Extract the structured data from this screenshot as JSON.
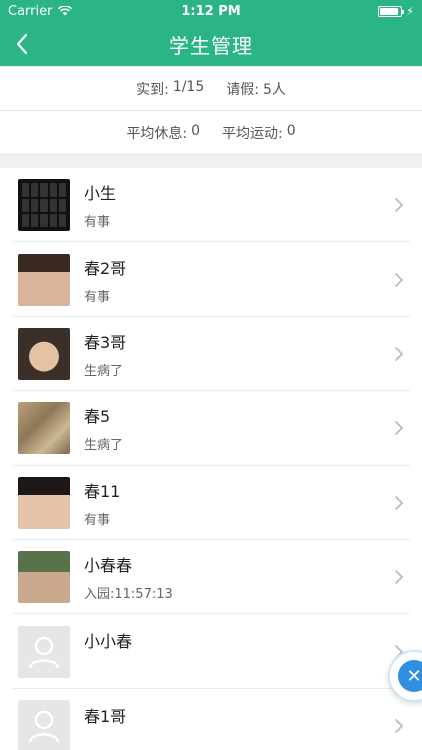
{
  "status_bar": {
    "carrier": "Carrier",
    "time": "1:12 PM",
    "battery_percent": 90
  },
  "nav": {
    "title": "学生管理"
  },
  "stats": {
    "arrived_label": "实到:",
    "arrived_value": "1/15",
    "leave_label": "请假:",
    "leave_value": "5人",
    "rest_label": "平均休息:",
    "rest_value": "0",
    "sport_label": "平均运动:",
    "sport_value": "0"
  },
  "students": [
    {
      "name": "小生",
      "status": "有事",
      "avatar": "keyboard-photo"
    },
    {
      "name": "春2哥",
      "status": "有事",
      "avatar": "face-photo"
    },
    {
      "name": "春3哥",
      "status": "生病了",
      "avatar": "face-photo"
    },
    {
      "name": "春5",
      "status": "生病了",
      "avatar": "ground-photo"
    },
    {
      "name": "春11",
      "status": "有事",
      "avatar": "face-photo"
    },
    {
      "name": "小春春",
      "status": "入园:11:57:13",
      "avatar": "face-photo"
    },
    {
      "name": "小小春",
      "status": "",
      "avatar": "placeholder"
    },
    {
      "name": "春1哥",
      "status": "",
      "avatar": "placeholder"
    }
  ],
  "colors": {
    "header": "#2bb584",
    "fab": "#2f8fe0"
  }
}
